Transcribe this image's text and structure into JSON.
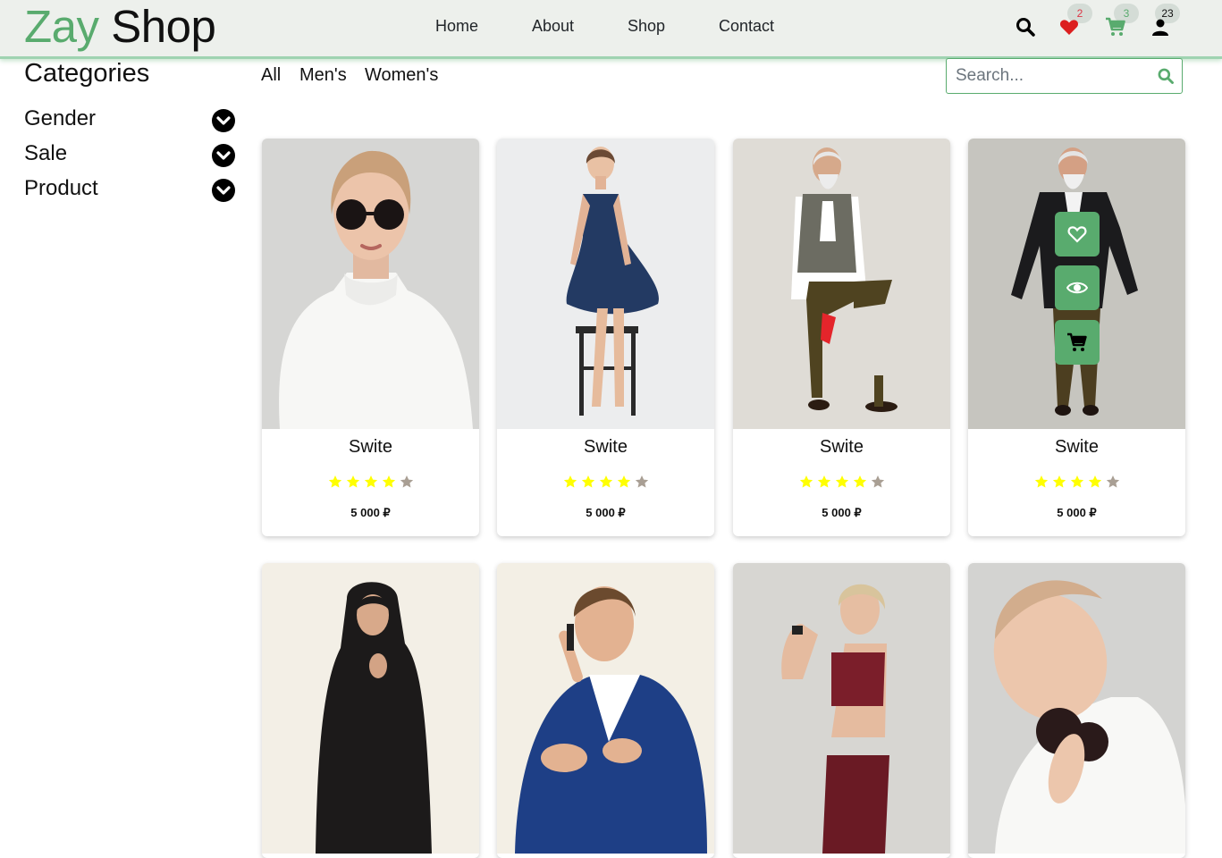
{
  "header": {
    "logo_part1": "Zay",
    "logo_part2": "Shop",
    "nav": [
      "Home",
      "About",
      "Shop",
      "Contact"
    ],
    "wishlist_count": "2",
    "cart_count": "3",
    "user_count": "23"
  },
  "sidebar": {
    "title": "Categories",
    "items": [
      {
        "label": "Gender",
        "icon": "chevron-down-icon"
      },
      {
        "label": "Sale",
        "icon": "chevron-down-icon"
      },
      {
        "label": "Product",
        "icon": "chevron-down-icon"
      }
    ]
  },
  "filters": [
    "All",
    "Men's",
    "Women's"
  ],
  "search": {
    "placeholder": "Search..."
  },
  "products": [
    {
      "name": "Swite",
      "rating": 4,
      "max_rating": 5,
      "price": "5 000 ₽"
    },
    {
      "name": "Swite",
      "rating": 4,
      "max_rating": 5,
      "price": "5 000 ₽"
    },
    {
      "name": "Swite",
      "rating": 4,
      "max_rating": 5,
      "price": "5 000 ₽"
    },
    {
      "name": "Swite",
      "rating": 4,
      "max_rating": 5,
      "price": "5 000 ₽"
    }
  ],
  "colors": {
    "accent": "#59ab6e",
    "header_bg": "#edf0ec",
    "star_filled": "#ffff00",
    "star_empty": "#a99f94",
    "wishlist_badge": "#dc3545"
  }
}
